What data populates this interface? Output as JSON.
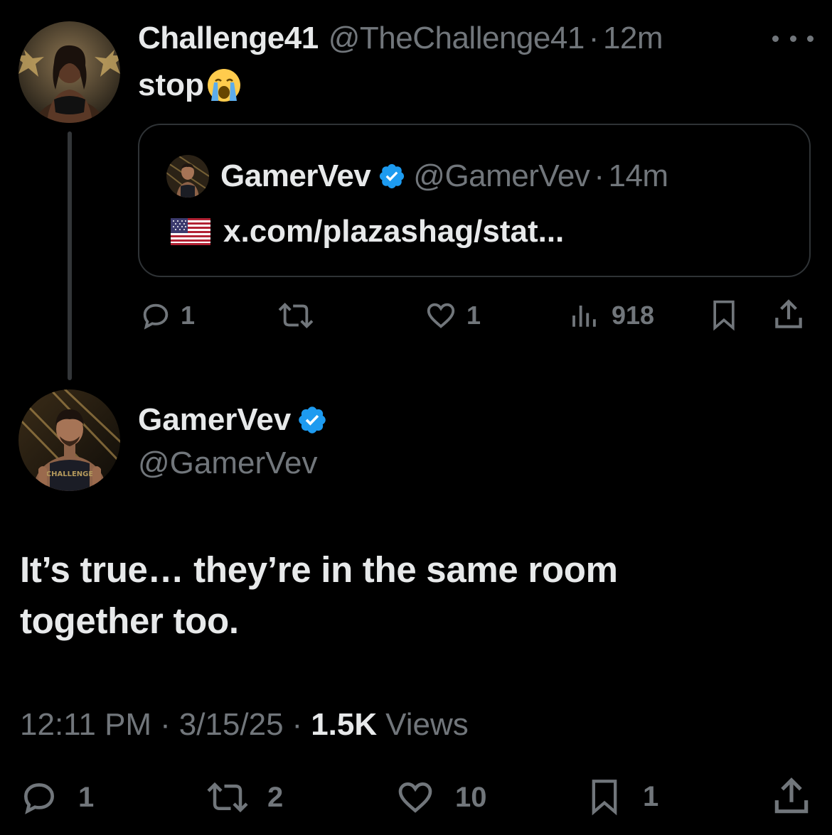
{
  "parent_tweet": {
    "display_name": "Challenge41",
    "handle": "@TheChallenge41",
    "separator": "·",
    "time": "12m",
    "text": "stop",
    "emoji": "loudly-crying-face",
    "quoted": {
      "display_name": "GamerVev",
      "handle": "@GamerVev",
      "separator": "·",
      "time": "14m",
      "flag": "us-flag",
      "link_text": "x.com/plazashag/stat..."
    },
    "actions": {
      "replies": "1",
      "reposts": "",
      "likes": "1",
      "views": "918"
    }
  },
  "main_tweet": {
    "display_name": "GamerVev",
    "handle": "@GamerVev",
    "verified": true,
    "text_line1": "It’s true… they’re in the same room",
    "text_line2": "together too.",
    "time": "12:11 PM",
    "date": "3/15/25",
    "separator": "·",
    "views_count": "1.5K",
    "views_label": "Views",
    "actions": {
      "replies": "1",
      "reposts": "2",
      "likes": "10",
      "bookmarks": "1"
    }
  },
  "colors": {
    "background": "#000000",
    "text_primary": "#e7e9ea",
    "text_muted": "#71767b",
    "verified_blue": "#1d9bf0",
    "border": "#2f3336"
  }
}
